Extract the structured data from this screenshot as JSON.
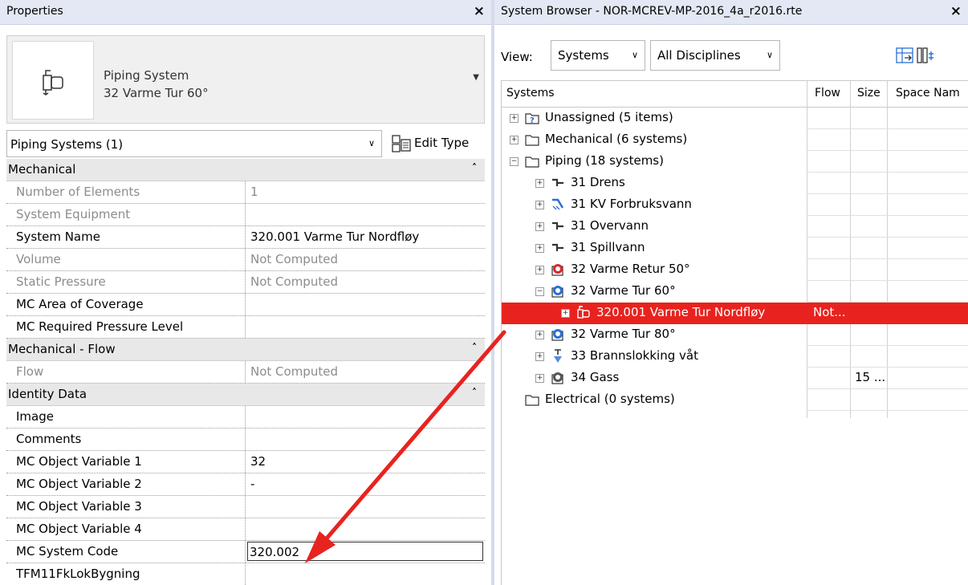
{
  "properties": {
    "title": "Properties",
    "close": "×",
    "type_category": "Piping System",
    "type_name": "32 Varme Tur 60°",
    "instance_selector": "Piping Systems (1)",
    "edit_type": "Edit Type",
    "groups": [
      {
        "name": "Mechanical",
        "rows": [
          {
            "label": "Number of Elements",
            "value": "1",
            "grey": true
          },
          {
            "label": "System Equipment",
            "value": "",
            "grey": true
          },
          {
            "label": "System Name",
            "value": "320.001 Varme Tur Nordfløy",
            "grey": false
          },
          {
            "label": "Volume",
            "value": "Not Computed",
            "grey": true
          },
          {
            "label": "Static Pressure",
            "value": "Not Computed",
            "grey": true
          },
          {
            "label": "MC Area of Coverage",
            "value": "",
            "grey": false
          },
          {
            "label": "MC Required Pressure Level",
            "value": "",
            "grey": false
          }
        ]
      },
      {
        "name": "Mechanical - Flow",
        "rows": [
          {
            "label": "Flow",
            "value": "Not Computed",
            "grey": true
          }
        ]
      },
      {
        "name": "Identity Data",
        "rows": [
          {
            "label": "Image",
            "value": "",
            "grey": false
          },
          {
            "label": "Comments",
            "value": "",
            "grey": false
          },
          {
            "label": "MC Object Variable 1",
            "value": "32",
            "grey": false
          },
          {
            "label": "MC Object Variable 2",
            "value": "-",
            "grey": false
          },
          {
            "label": "MC Object Variable 3",
            "value": "",
            "grey": false
          },
          {
            "label": "MC Object Variable 4",
            "value": "",
            "grey": false
          },
          {
            "label": "MC System Code",
            "value": "320.002",
            "grey": false,
            "editing": true
          },
          {
            "label": "TFM11FkLokBygning",
            "value": "",
            "grey": false
          }
        ]
      }
    ]
  },
  "browser": {
    "title": "System Browser - NOR-MCREV-MP-2016_4a_r2016.rte",
    "close": "×",
    "view_label": "View:",
    "view_value": "Systems",
    "discipline_value": "All Disciplines",
    "columns": [
      "Systems",
      "Flow",
      "Size",
      "Space Nam"
    ],
    "rows": [
      {
        "level": 0,
        "expander": "+",
        "icon": "folder-question-icon",
        "label": "Unassigned (5 items)",
        "flow": "",
        "size": ""
      },
      {
        "level": 0,
        "expander": "+",
        "icon": "folder-icon",
        "label": "Mechanical (6 systems)",
        "flow": "",
        "size": ""
      },
      {
        "level": 0,
        "expander": "−",
        "icon": "folder-icon",
        "label": "Piping (18 systems)",
        "flow": "",
        "size": ""
      },
      {
        "level": 1,
        "expander": "+",
        "icon": "drain-icon",
        "label": "31 Drens",
        "flow": "",
        "size": ""
      },
      {
        "level": 1,
        "expander": "+",
        "icon": "cold-water-icon",
        "label": "31 KV Forbruksvann",
        "flow": "",
        "size": ""
      },
      {
        "level": 1,
        "expander": "+",
        "icon": "drain-icon",
        "label": "31 Overvann",
        "flow": "",
        "size": ""
      },
      {
        "level": 1,
        "expander": "+",
        "icon": "drain-icon",
        "label": "31 Spillvann",
        "flow": "",
        "size": ""
      },
      {
        "level": 1,
        "expander": "+",
        "icon": "hydronic-return-icon",
        "label": "32 Varme Retur 50°",
        "flow": "",
        "size": ""
      },
      {
        "level": 1,
        "expander": "−",
        "icon": "hydronic-supply-icon",
        "label": "32 Varme Tur 60°",
        "flow": "",
        "size": ""
      },
      {
        "level": 2,
        "expander": "+",
        "icon": "piping-system-icon",
        "label": "320.001 Varme Tur Nordfløy",
        "flow": "Not...",
        "size": "",
        "selected": true
      },
      {
        "level": 1,
        "expander": "+",
        "icon": "hydronic-supply-icon",
        "label": "32 Varme Tur 80°",
        "flow": "",
        "size": ""
      },
      {
        "level": 1,
        "expander": "+",
        "icon": "sprinkler-icon",
        "label": "33 Brannslokking våt",
        "flow": "",
        "size": ""
      },
      {
        "level": 1,
        "expander": "+",
        "icon": "gas-icon",
        "label": "34 Gass",
        "flow": "",
        "size": "15 ..."
      },
      {
        "level": 0,
        "expander": "",
        "icon": "folder-icon",
        "label": "Electrical (0 systems)",
        "flow": "",
        "size": ""
      }
    ]
  },
  "colors": {
    "selection": "#e8231f",
    "annotation_arrow": "#e8231f",
    "supply": "#2a6fd6",
    "return": "#d62a2a"
  }
}
